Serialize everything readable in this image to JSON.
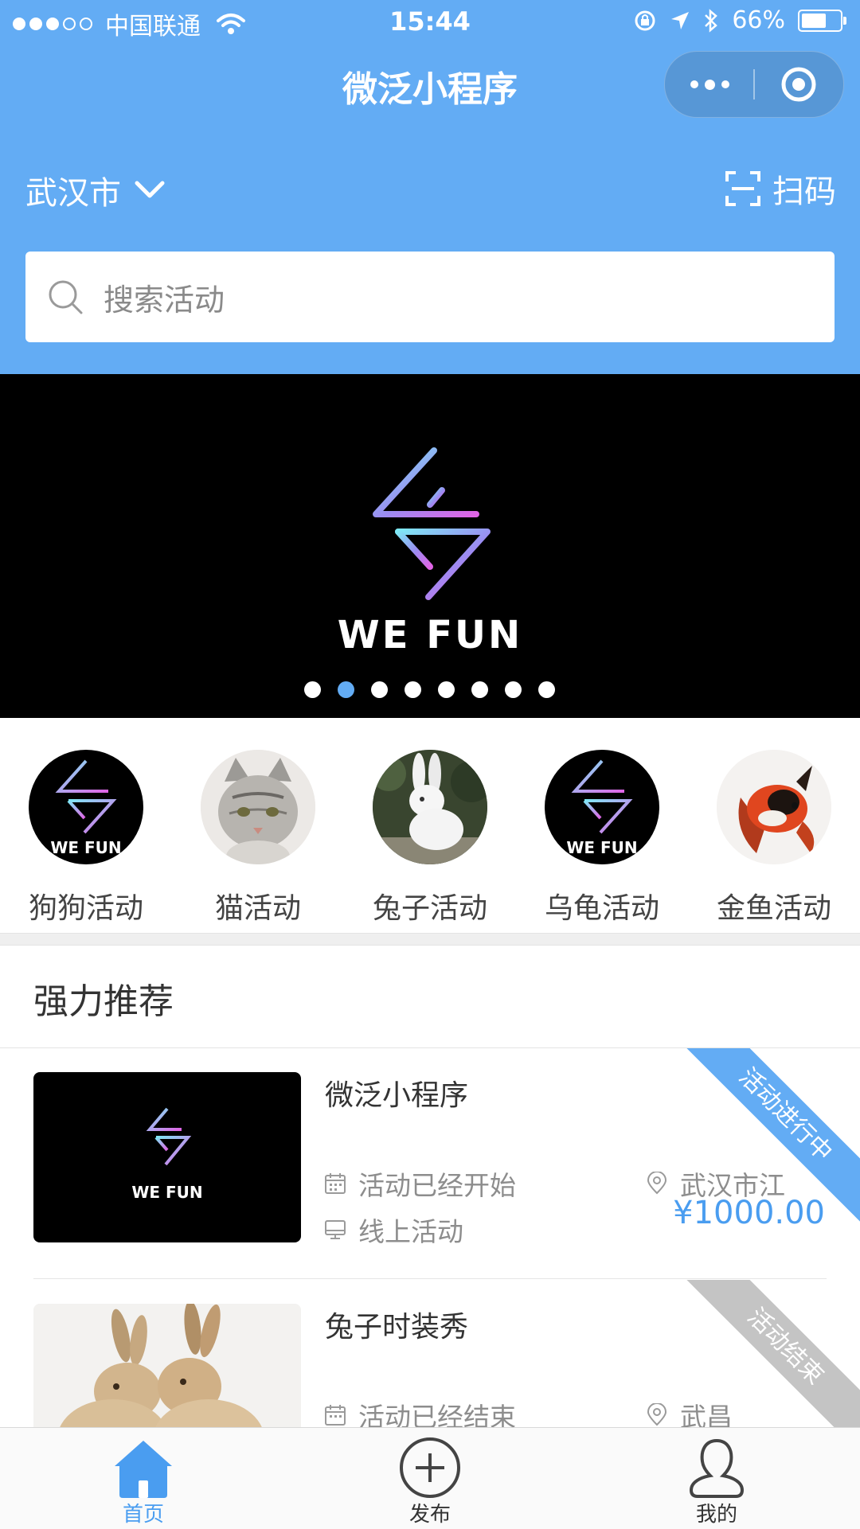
{
  "status_bar": {
    "carrier": "中国联通",
    "time": "15:44",
    "battery_percent": "66%",
    "battery_level": 0.66
  },
  "nav": {
    "title": "微泛小程序"
  },
  "location": {
    "city": "武汉市",
    "scan_label": "扫码"
  },
  "search": {
    "placeholder": "搜索活动"
  },
  "banner": {
    "brand_text": "WE FUN",
    "page_count": 8,
    "active_index": 1
  },
  "categories": [
    {
      "label": "狗狗活动",
      "image": "wefun-logo"
    },
    {
      "label": "猫活动",
      "image": "cat-photo"
    },
    {
      "label": "兔子活动",
      "image": "rabbit-photo"
    },
    {
      "label": "乌龟活动",
      "image": "wefun-logo"
    },
    {
      "label": "金鱼活动",
      "image": "goldfish-photo"
    }
  ],
  "recommend": {
    "title": "强力推荐",
    "items": [
      {
        "name": "微泛小程序",
        "status_text": "活动已经开始",
        "type_text": "线上活动",
        "location": "武汉市江",
        "price": "¥1000.00",
        "ribbon": "活动进行中",
        "ribbon_color": "#63acf4"
      },
      {
        "name": "兔子时装秀",
        "status_text": "活动已经结束",
        "location": "武昌",
        "ribbon": "活动结束",
        "ribbon_color": "#c4c4c4"
      }
    ]
  },
  "tabbar": {
    "items": [
      {
        "label": "首页",
        "icon": "home-icon",
        "active": true
      },
      {
        "label": "发布",
        "icon": "plus-circle-icon",
        "active": false
      },
      {
        "label": "我的",
        "icon": "user-icon",
        "active": false
      }
    ]
  },
  "colors": {
    "primary": "#63acf4",
    "price": "#4a9df0",
    "ended": "#c4c4c4"
  }
}
